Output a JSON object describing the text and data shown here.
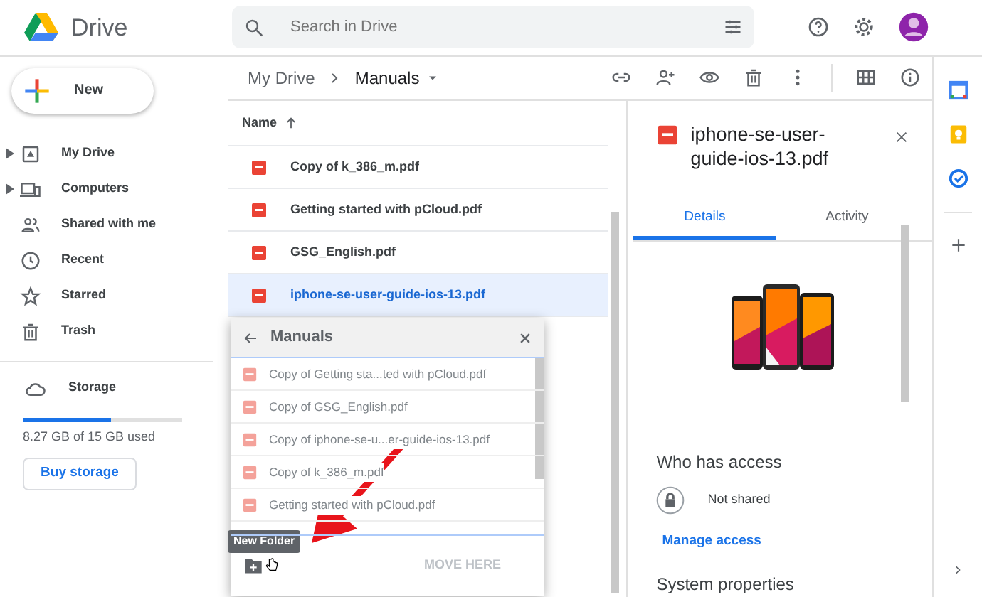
{
  "header": {
    "app_name": "Drive",
    "search": {
      "placeholder": "Search in Drive"
    }
  },
  "new_button": "New",
  "sidebar": {
    "items": [
      {
        "label": "My Drive",
        "kind": "tree"
      },
      {
        "label": "Computers",
        "kind": "tree"
      },
      {
        "label": "Shared with me",
        "kind": "link"
      },
      {
        "label": "Recent",
        "kind": "link"
      },
      {
        "label": "Starred",
        "kind": "link"
      },
      {
        "label": "Trash",
        "kind": "link"
      }
    ],
    "storage": {
      "label": "Storage",
      "level": 0.55,
      "usage": "8.27 GB of 15 GB used",
      "button": "Buy storage"
    }
  },
  "breadcrumb": [
    "My Drive",
    "Manuals"
  ],
  "file_list": {
    "column": "Name",
    "files": [
      {
        "name": "Copy of k_386_m.pdf",
        "selected": false
      },
      {
        "name": "Getting started with pCloud.pdf",
        "selected": false
      },
      {
        "name": "GSG_English.pdf",
        "selected": false
      },
      {
        "name": "iphone-se-user-guide-ios-13.pdf",
        "selected": true
      }
    ]
  },
  "move_dialog": {
    "title": "Manuals",
    "items": [
      {
        "name": "Copy of Getting sta...ted with pCloud.pdf",
        "disabled": true
      },
      {
        "name": "Copy of GSG_English.pdf",
        "disabled": true
      },
      {
        "name": "Copy of iphone-se-u...er-guide-ios-13.pdf",
        "disabled": true
      },
      {
        "name": "Copy of k_386_m.pdf",
        "disabled": true
      },
      {
        "name": "Getting started with pCloud.pdf",
        "disabled": true
      }
    ],
    "tooltip": "New Folder",
    "move_button": {
      "label": "MOVE HERE",
      "disabled": true
    }
  },
  "details": {
    "title": "iphone-se-user-guide-ios-13.pdf",
    "tabs": [
      {
        "label": "Details",
        "selected": true
      },
      {
        "label": "Activity",
        "selected": false
      }
    ],
    "access_heading": "Who has access",
    "sharing": "Not shared",
    "manage_link": "Manage access",
    "properties_heading": "System properties"
  }
}
